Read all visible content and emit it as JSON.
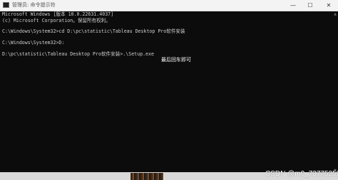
{
  "window": {
    "title": "管理员: 命令提示符",
    "minimize_glyph": "—",
    "maximize_glyph": "☐",
    "close_glyph": "✕"
  },
  "terminal": {
    "lines": [
      "Microsoft Windows [版本 10.0.22631.4037]",
      "(c) Microsoft Corporation。保留所有权利。",
      "",
      "C:\\Windows\\System32>cd D:\\pc\\statistic\\Tableau Desktop Pro软件安装",
      "",
      "C:\\Windows\\System32>D:",
      "",
      "D:\\pc\\statistic\\Tableau Desktop Pro软件安装>.\\Setup.exe"
    ]
  },
  "annotation": "最后回车即可",
  "watermark": "CSDN @m0_73775252",
  "colors": {
    "terminal_bg": "#0c0c0c",
    "terminal_text": "#cccccc",
    "titlebar_bg": "#f3f3f3"
  }
}
